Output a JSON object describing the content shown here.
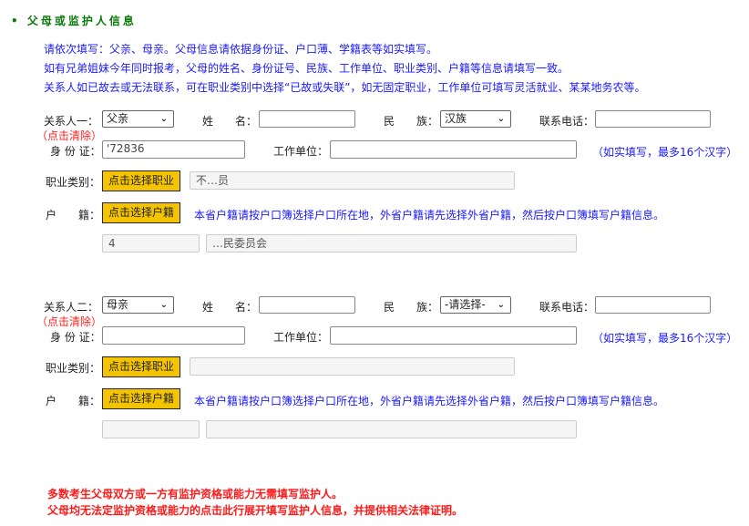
{
  "section_title": "父母或监护人信息",
  "instructions": [
    "请依次填写：父亲、母亲。父母信息请依据身份证、户口薄、学籍表等如实填写。",
    "如有兄弟姐妹今年同时报考，父母的姓名、身份证号、民族、工作单位、职业类别、户籍等信息请填写一致。",
    "关系人如已故去或无法联系，可在职业类别中选择“已故或失联”，如无固定职业，工作单位可填写灵活就业、某某地务农等。"
  ],
  "labels": {
    "name": "姓　　名：",
    "ethnicity": "民　　族：",
    "phone": "联系电话：",
    "id": "身 份 证：",
    "work": "工作单位：",
    "occupation": "职业类别：",
    "household": "户　　籍：",
    "clear": "（点击清除）",
    "work_hint": "（如实填写，最多16个汉字）",
    "household_hint": "本省户籍请按户口簿选择户口所在地，外省户籍请先选择外省户籍，然后按户口簿填写户籍信息。",
    "choose_occupation": "点击选择职业",
    "choose_household": "点击选择户籍"
  },
  "contacts": [
    {
      "label": "关系人一：",
      "relation": "父亲",
      "name": "",
      "ethnicity": "汉族",
      "phone": "",
      "id": "'72836",
      "work": "",
      "occupation": "不…员",
      "household_code": "4",
      "household_addr": "…民委员会"
    },
    {
      "label": "关系人二：",
      "relation": "母亲",
      "name": "",
      "ethnicity": "-请选择-",
      "phone": "",
      "id": "",
      "work": "",
      "occupation": "",
      "household_code": "",
      "household_addr": ""
    }
  ],
  "warnings": [
    "多数考生父母双方或一方有监护资格或能力无需填写监护人。",
    "父母均无法定监护资格或能力的点击此行展开填写监护人信息，并提供相关法律证明。"
  ]
}
